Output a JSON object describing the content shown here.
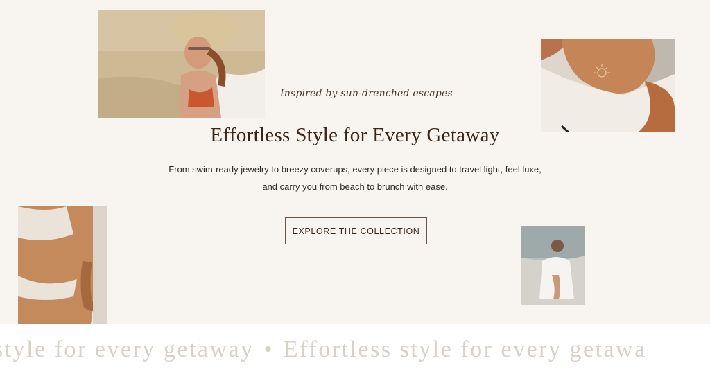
{
  "hero": {
    "eyebrow": "Inspired by sun-drenched escapes",
    "headline": "Effortless Style for Every Getaway",
    "body": "From swim-ready jewelry to breezy coverups, every piece is designed to travel light, feel luxe, and carry you from beach to brunch with ease.",
    "cta_label": "EXPLORE THE COLLECTION"
  },
  "marquee": {
    "items": [
      "style for every getaway",
      "Effortless style for every getawa"
    ],
    "separator": "•"
  },
  "colors": {
    "background": "#f8f5f1",
    "headline": "#3b2518",
    "button_border": "#6b5443",
    "marquee_text": "#d8d1c8"
  }
}
